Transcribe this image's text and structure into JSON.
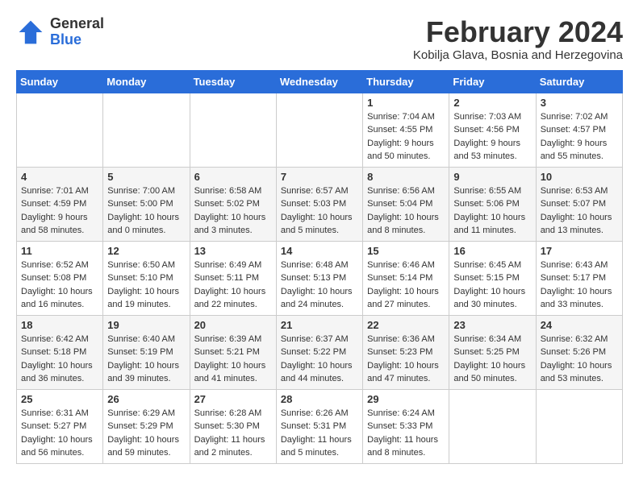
{
  "logo": {
    "general": "General",
    "blue": "Blue"
  },
  "title": "February 2024",
  "subtitle": "Kobilja Glava, Bosnia and Herzegovina",
  "days_of_week": [
    "Sunday",
    "Monday",
    "Tuesday",
    "Wednesday",
    "Thursday",
    "Friday",
    "Saturday"
  ],
  "weeks": [
    [
      {
        "day": "",
        "info": ""
      },
      {
        "day": "",
        "info": ""
      },
      {
        "day": "",
        "info": ""
      },
      {
        "day": "",
        "info": ""
      },
      {
        "day": "1",
        "sunrise": "Sunrise: 7:04 AM",
        "sunset": "Sunset: 4:55 PM",
        "daylight": "Daylight: 9 hours and 50 minutes."
      },
      {
        "day": "2",
        "sunrise": "Sunrise: 7:03 AM",
        "sunset": "Sunset: 4:56 PM",
        "daylight": "Daylight: 9 hours and 53 minutes."
      },
      {
        "day": "3",
        "sunrise": "Sunrise: 7:02 AM",
        "sunset": "Sunset: 4:57 PM",
        "daylight": "Daylight: 9 hours and 55 minutes."
      }
    ],
    [
      {
        "day": "4",
        "sunrise": "Sunrise: 7:01 AM",
        "sunset": "Sunset: 4:59 PM",
        "daylight": "Daylight: 9 hours and 58 minutes."
      },
      {
        "day": "5",
        "sunrise": "Sunrise: 7:00 AM",
        "sunset": "Sunset: 5:00 PM",
        "daylight": "Daylight: 10 hours and 0 minutes."
      },
      {
        "day": "6",
        "sunrise": "Sunrise: 6:58 AM",
        "sunset": "Sunset: 5:02 PM",
        "daylight": "Daylight: 10 hours and 3 minutes."
      },
      {
        "day": "7",
        "sunrise": "Sunrise: 6:57 AM",
        "sunset": "Sunset: 5:03 PM",
        "daylight": "Daylight: 10 hours and 5 minutes."
      },
      {
        "day": "8",
        "sunrise": "Sunrise: 6:56 AM",
        "sunset": "Sunset: 5:04 PM",
        "daylight": "Daylight: 10 hours and 8 minutes."
      },
      {
        "day": "9",
        "sunrise": "Sunrise: 6:55 AM",
        "sunset": "Sunset: 5:06 PM",
        "daylight": "Daylight: 10 hours and 11 minutes."
      },
      {
        "day": "10",
        "sunrise": "Sunrise: 6:53 AM",
        "sunset": "Sunset: 5:07 PM",
        "daylight": "Daylight: 10 hours and 13 minutes."
      }
    ],
    [
      {
        "day": "11",
        "sunrise": "Sunrise: 6:52 AM",
        "sunset": "Sunset: 5:08 PM",
        "daylight": "Daylight: 10 hours and 16 minutes."
      },
      {
        "day": "12",
        "sunrise": "Sunrise: 6:50 AM",
        "sunset": "Sunset: 5:10 PM",
        "daylight": "Daylight: 10 hours and 19 minutes."
      },
      {
        "day": "13",
        "sunrise": "Sunrise: 6:49 AM",
        "sunset": "Sunset: 5:11 PM",
        "daylight": "Daylight: 10 hours and 22 minutes."
      },
      {
        "day": "14",
        "sunrise": "Sunrise: 6:48 AM",
        "sunset": "Sunset: 5:13 PM",
        "daylight": "Daylight: 10 hours and 24 minutes."
      },
      {
        "day": "15",
        "sunrise": "Sunrise: 6:46 AM",
        "sunset": "Sunset: 5:14 PM",
        "daylight": "Daylight: 10 hours and 27 minutes."
      },
      {
        "day": "16",
        "sunrise": "Sunrise: 6:45 AM",
        "sunset": "Sunset: 5:15 PM",
        "daylight": "Daylight: 10 hours and 30 minutes."
      },
      {
        "day": "17",
        "sunrise": "Sunrise: 6:43 AM",
        "sunset": "Sunset: 5:17 PM",
        "daylight": "Daylight: 10 hours and 33 minutes."
      }
    ],
    [
      {
        "day": "18",
        "sunrise": "Sunrise: 6:42 AM",
        "sunset": "Sunset: 5:18 PM",
        "daylight": "Daylight: 10 hours and 36 minutes."
      },
      {
        "day": "19",
        "sunrise": "Sunrise: 6:40 AM",
        "sunset": "Sunset: 5:19 PM",
        "daylight": "Daylight: 10 hours and 39 minutes."
      },
      {
        "day": "20",
        "sunrise": "Sunrise: 6:39 AM",
        "sunset": "Sunset: 5:21 PM",
        "daylight": "Daylight: 10 hours and 41 minutes."
      },
      {
        "day": "21",
        "sunrise": "Sunrise: 6:37 AM",
        "sunset": "Sunset: 5:22 PM",
        "daylight": "Daylight: 10 hours and 44 minutes."
      },
      {
        "day": "22",
        "sunrise": "Sunrise: 6:36 AM",
        "sunset": "Sunset: 5:23 PM",
        "daylight": "Daylight: 10 hours and 47 minutes."
      },
      {
        "day": "23",
        "sunrise": "Sunrise: 6:34 AM",
        "sunset": "Sunset: 5:25 PM",
        "daylight": "Daylight: 10 hours and 50 minutes."
      },
      {
        "day": "24",
        "sunrise": "Sunrise: 6:32 AM",
        "sunset": "Sunset: 5:26 PM",
        "daylight": "Daylight: 10 hours and 53 minutes."
      }
    ],
    [
      {
        "day": "25",
        "sunrise": "Sunrise: 6:31 AM",
        "sunset": "Sunset: 5:27 PM",
        "daylight": "Daylight: 10 hours and 56 minutes."
      },
      {
        "day": "26",
        "sunrise": "Sunrise: 6:29 AM",
        "sunset": "Sunset: 5:29 PM",
        "daylight": "Daylight: 10 hours and 59 minutes."
      },
      {
        "day": "27",
        "sunrise": "Sunrise: 6:28 AM",
        "sunset": "Sunset: 5:30 PM",
        "daylight": "Daylight: 11 hours and 2 minutes."
      },
      {
        "day": "28",
        "sunrise": "Sunrise: 6:26 AM",
        "sunset": "Sunset: 5:31 PM",
        "daylight": "Daylight: 11 hours and 5 minutes."
      },
      {
        "day": "29",
        "sunrise": "Sunrise: 6:24 AM",
        "sunset": "Sunset: 5:33 PM",
        "daylight": "Daylight: 11 hours and 8 minutes."
      },
      {
        "day": "",
        "info": ""
      },
      {
        "day": "",
        "info": ""
      }
    ]
  ]
}
